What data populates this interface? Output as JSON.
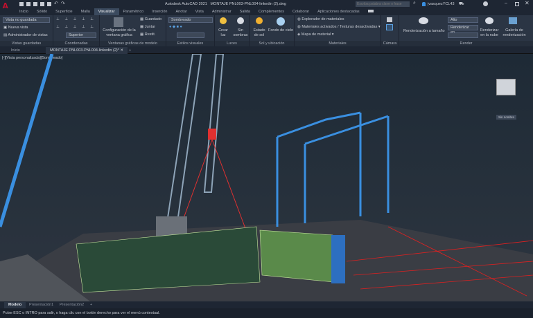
{
  "app": {
    "title": "Autodesk AutoCAD 2021",
    "document": "MONTAJE PNL003-PNL004-linkedin (2).dwg",
    "logo": "A",
    "search_placeholder": "Escriba palabra clave o frase",
    "user": "jvasquezYCL43"
  },
  "menu_tabs": [
    "Inicio",
    "Sólido",
    "Superficie",
    "Malla",
    "Visualizar",
    "Paramétrico",
    "Inserción",
    "Anotar",
    "Vista",
    "Administrar",
    "Salida",
    "Complementos",
    "Colaborar",
    "Aplicaciones destacadas"
  ],
  "active_tab": "Visualizar",
  "ribbon": {
    "vistas": {
      "dropdown": "Vista no guardada",
      "nueva": "Nueva vista",
      "admin": "Administrador de vistas",
      "label": "Vistas guardadas"
    },
    "coordenadas": {
      "dropdown": "Superior",
      "label": "Coordenadas"
    },
    "ventanas": {
      "config": "Configuración de la ventana gráfica",
      "guardado": "Guardado",
      "juntar": "Juntar",
      "restit": "Restit.",
      "label": "Ventanas gráficas de modelo"
    },
    "estilos": {
      "dropdown": "Sombreado",
      "label": "Estilos visuales"
    },
    "luces": {
      "crear": "Crear luz",
      "sin": "Sin sombras",
      "label": "Luces"
    },
    "sol": {
      "estado": "Estado de sol",
      "fondo": "Fondo de cielo",
      "label": "Sol y ubicación"
    },
    "materiales": {
      "explorador": "Explorador de materiales",
      "activados": "Materiales activados / Texturas desactivadas",
      "mapa": "Mapa de material",
      "label": "Materiales"
    },
    "camara": {
      "label": "Cámara"
    },
    "render": {
      "tamano": "Renderización a tamaño",
      "calidad": "Alto",
      "destino": "Renderizar en...",
      "nube": "Renderizar en la nube",
      "galeria": "Galería de renderización",
      "label": "Render"
    }
  },
  "file_tabs": [
    {
      "label": "Inicio"
    },
    {
      "label": "MONTAJE PNL003-PNL004-linkedin (2)*",
      "active": true
    }
  ],
  "viewport": {
    "label": "[-][Vista personalizada][Sombreado]",
    "viewcube_label": "Sin nombre"
  },
  "layout_tabs": [
    "Modelo",
    "Presentación1",
    "Presentación2"
  ],
  "command_line": "Pulse ESC o INTRO para salir, o haga clic con el botón derecho para ver el menú contextual.",
  "colors": {
    "accent": "#3b4a5e",
    "logo": "#c8102e",
    "structure": "#3a8fe0",
    "rebar": "#e02020",
    "mesh": "#c8e8a0"
  }
}
